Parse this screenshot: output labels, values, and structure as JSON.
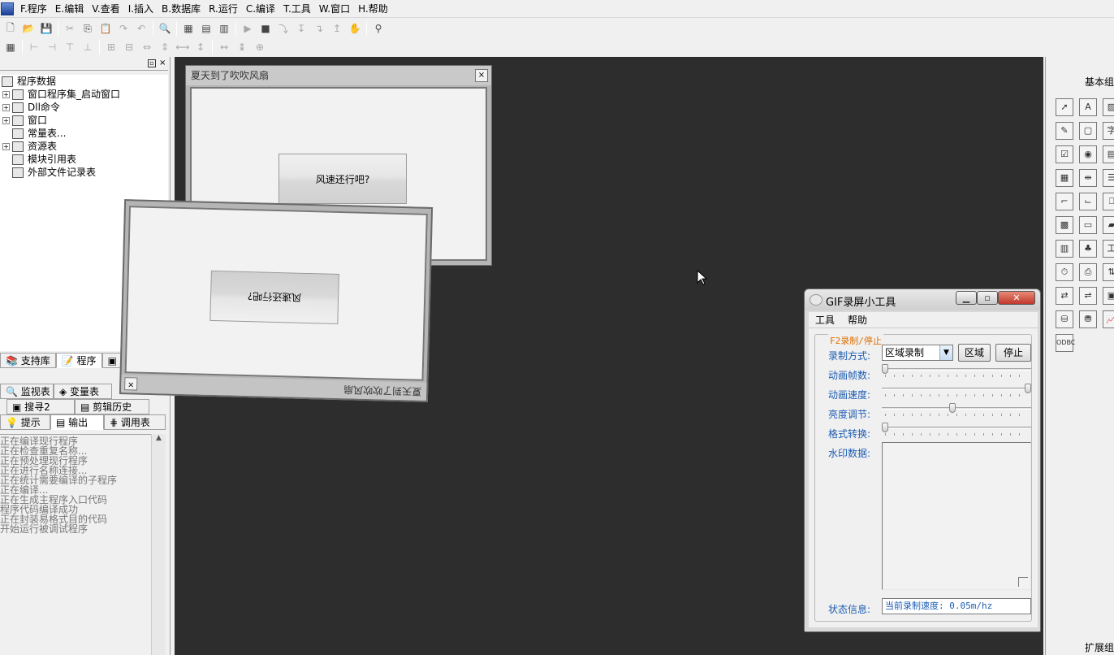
{
  "menu": [
    "F.程序",
    "E.编辑",
    "V.查看",
    "I.插入",
    "B.数据库",
    "R.运行",
    "C.编译",
    "T.工具",
    "W.窗口",
    "H.帮助"
  ],
  "tree": {
    "root": "程序数据",
    "items": [
      "窗口程序集_启动窗口",
      "Dll命令",
      "窗口",
      "常量表...",
      "资源表",
      "模块引用表",
      "外部文件记录表"
    ]
  },
  "left_tabs": {
    "support": "支持库",
    "program": "程序"
  },
  "bottom_tabs_row1": [
    "监视表",
    "变量表"
  ],
  "bottom_tabs_row2": [
    "搜寻2",
    "剪辑历史"
  ],
  "bottom_tabs_row3": [
    "提示",
    "输出",
    "调用表"
  ],
  "output_lines": [
    "正在编译现行程序",
    "正在检查重复名称...",
    "正在预处理现行程序",
    "正在进行名称连接...",
    "正在统计需要编译的子程序",
    "正在编译...",
    "正在生成主程序入口代码",
    "程序代码编译成功",
    "正在封装易格式目的代码",
    "开始运行被调试程序"
  ],
  "win_a": {
    "title": "夏天到了吹吹风扇",
    "button": "风速还行吧?"
  },
  "win_b": {
    "title": "夏天到了吹吹风扇",
    "button": "风速还行吧?"
  },
  "gif_tool": {
    "title": "GIF录屏小工具",
    "menu": [
      "工具",
      "帮助"
    ],
    "group": "F2录制/停止",
    "record_mode_label": "录制方式:",
    "record_mode_value": "区域录制",
    "region_button": "区域",
    "stop_button": "停止",
    "frames_label": "动画帧数:",
    "speed_label": "动画速度:",
    "brightness_label": "亮度调节:",
    "format_label": "格式转换:",
    "watermark_label": "水印数据:",
    "status_label": "状态信息:",
    "status_value": "当前录制速度: 0.05m/hz",
    "frames_level": 0.0,
    "speed_level": 1.0,
    "brightness_level": 0.47,
    "format_level": 0.0
  },
  "right_pane": {
    "top_label": "基本组",
    "bottom_label": "扩展组"
  }
}
